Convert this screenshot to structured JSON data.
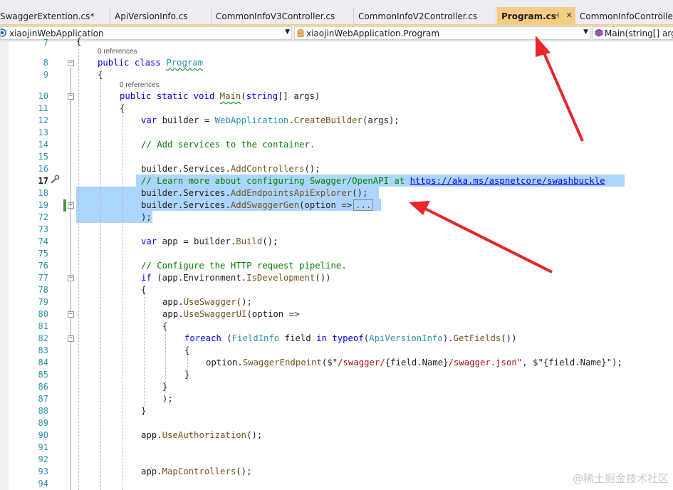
{
  "tabs": [
    {
      "label": "SwaggerExtention.cs*",
      "active": false
    },
    {
      "label": "ApiVersionInfo.cs",
      "active": false
    },
    {
      "label": "CommonInfoV3Controller.cs",
      "active": false
    },
    {
      "label": "CommonInfoV2Controller.cs",
      "active": false
    },
    {
      "label": "Program.cs",
      "active": true
    },
    {
      "label": "CommonInfoController.cs",
      "active": false
    }
  ],
  "tab_pin_icon": "⊣",
  "tab_close_icon": "✕",
  "nav": {
    "project": "xiaojinWebApplication",
    "type": "xiaojinWebApplication.Program",
    "member": "Main(string[] args)"
  },
  "codelens": {
    "program_refs": "0 references",
    "main_refs": "0 references"
  },
  "line_numbers": [
    "7",
    "8",
    "9",
    "10",
    "11",
    "12",
    "13",
    "14",
    "15",
    "16",
    "17",
    "18",
    "19",
    "72",
    "73",
    "74",
    "75",
    "76",
    "77",
    "78",
    "79",
    "80",
    "81",
    "82",
    "83",
    "84",
    "85",
    "86",
    "87",
    "88",
    "89",
    "90",
    "91",
    "92",
    "93",
    "94"
  ],
  "code": {
    "l8_kw": "public class",
    "l8_type": "Program",
    "l10_kw1": "public static void",
    "l10_method": "Main",
    "l10_kw2": "string",
    "l10_rest": "[] args)",
    "l12_kw": "var",
    "l12_a": " builder = ",
    "l12_type": "WebApplication",
    "l12_method": "CreateBuilder",
    "l12_b": "(args);",
    "l14_comment": "// Add services to the container.",
    "l16_a": "builder.Services.",
    "l16_method": "AddControllers",
    "l16_b": "();",
    "l17_comment": "// Learn more about configuring Swagger/OpenAPI at ",
    "l17_link": "https://aka.ms/aspnetcore/swashbuckle",
    "l18_a": "builder.Services.",
    "l18_method": "AddEndpointsApiExplorer",
    "l18_b": "();",
    "l19_a": "builder.Services.",
    "l19_method": "AddSwaggerGen",
    "l19_b": "(option =>",
    "l19_collapsed": "...",
    "l72": ");",
    "l74_kw": "var",
    "l74_a": " app = builder.",
    "l74_method": "Build",
    "l74_b": "();",
    "l76_comment": "// Configure the HTTP request pipeline.",
    "l77_kw": "if",
    "l77_a": " (app.Environment.",
    "l77_method": "IsDevelopment",
    "l77_b": "())",
    "l79_a": "app.",
    "l79_method": "UseSwagger",
    "l79_b": "();",
    "l80_a": "app.",
    "l80_method": "UseSwaggerUI",
    "l80_b": "(option =>",
    "l82_kw1": "foreach",
    "l82_a": " (",
    "l82_type1": "FieldInfo",
    "l82_b": " field ",
    "l82_kw2": "in",
    "l82_kw3": "typeof",
    "l82_c": "(",
    "l82_type2": "ApiVersionInfo",
    "l82_d": ").",
    "l82_method": "GetFields",
    "l82_e": "())",
    "l84_a": "option.",
    "l84_method": "SwaggerEndpoint",
    "l84_b": "($\"",
    "l84_s1": "/swagger/",
    "l84_c": "{field.Name}",
    "l84_s2": "/swagger.json\"",
    "l84_d": ", $\"{field.Name}\");",
    "l87": ");",
    "l90_a": "app.",
    "l90_method": "UseAuthorization",
    "l90_b": "();",
    "l93_a": "app.",
    "l93_method": "MapControllers",
    "l93_b": "();",
    "brace_open": "{",
    "brace_close": "}"
  },
  "watermark": "@稀土掘金技术社区",
  "annotation_color": "#e8262b"
}
